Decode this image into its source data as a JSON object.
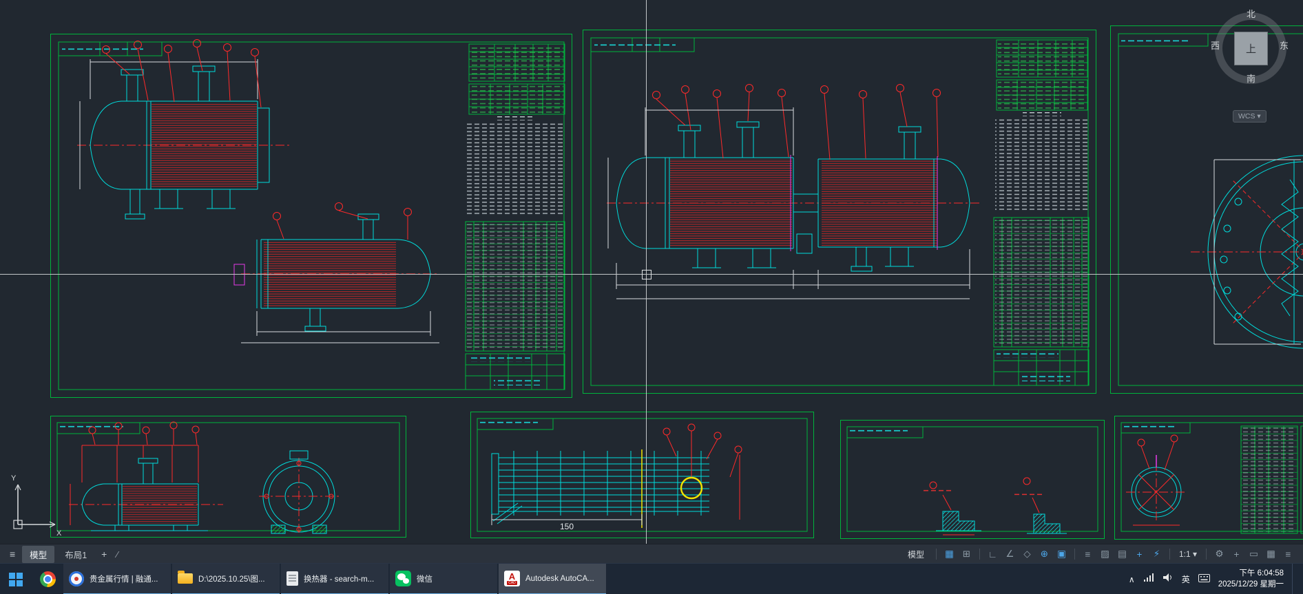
{
  "viewcube": {
    "north": "北",
    "east": "东",
    "south": "南",
    "west": "西",
    "top_face": "上",
    "wcs_label": "WCS ▾"
  },
  "ucs_axis": {
    "y": "Y",
    "x": "X"
  },
  "drawing": {
    "dim_150": "150"
  },
  "statusbar": {
    "menu_glyph": "≡",
    "model_tab": "模型",
    "layout_tab": "布局1",
    "new_layout_glyph": "+",
    "slash_glyph": "∕",
    "model_space_label": "模型",
    "icons": [
      {
        "name": "grid-icon",
        "glyph": "▦"
      },
      {
        "name": "snap-icon",
        "glyph": "⊞"
      },
      {
        "name": "ortho-icon",
        "glyph": "∟"
      },
      {
        "name": "polar-tracking-icon",
        "glyph": "∠"
      },
      {
        "name": "isodraft-icon",
        "glyph": "◇"
      },
      {
        "name": "osnap-tracking-icon",
        "glyph": "⊕"
      },
      {
        "name": "osnap-icon",
        "glyph": "▣"
      },
      {
        "name": "lineweight-icon",
        "glyph": "≡"
      },
      {
        "name": "transparency-icon",
        "glyph": "▨"
      },
      {
        "name": "selection-cycling-icon",
        "glyph": "▤"
      },
      {
        "name": "dynamic-input-icon",
        "glyph": "+"
      },
      {
        "name": "annotation-monitor-icon",
        "glyph": "⚡"
      }
    ],
    "scale_label": "1:1 ▾",
    "icons_right": [
      {
        "name": "workspace-gear-icon",
        "glyph": "⚙"
      },
      {
        "name": "annotation-add-icon",
        "glyph": "+"
      },
      {
        "name": "hardware-graphics-icon",
        "glyph": "▭"
      },
      {
        "name": "ui-layout-icon",
        "glyph": "▦"
      },
      {
        "name": "customize-icon",
        "glyph": "≡"
      }
    ]
  },
  "taskbar": {
    "apps": [
      {
        "label": "贵金属行情 | 融通..."
      },
      {
        "label": "D:\\2025.10.25\\图..."
      },
      {
        "label": "换热器 - search-m..."
      },
      {
        "label": "微信"
      },
      {
        "label": "Autodesk AutoCA..."
      }
    ],
    "autocad_icon_letter": "A",
    "autocad_icon_sub": "CAD",
    "tray": {
      "chevron": "∧",
      "lang": "英",
      "time": "下午 6:04:58",
      "date": "2025/12/29 星期一"
    }
  }
}
